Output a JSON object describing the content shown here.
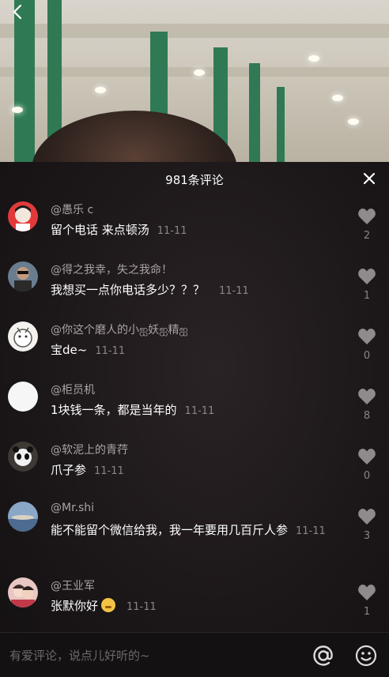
{
  "panel": {
    "title": "981条评论"
  },
  "comments": [
    {
      "user": "@愚乐 c",
      "text": "留个电话 来点顿汤",
      "time": "11-11",
      "likes": "2"
    },
    {
      "user": "@得之我幸，失之我命！",
      "text": "我想买一点你电话多少？？？",
      "time": "11-11",
      "likes": "1"
    },
    {
      "user": "@你这个磨人的小ஐ妖ஐ精ஐ",
      "text": "宝de~",
      "time": "11-11",
      "likes": "0"
    },
    {
      "user": "@柜员机",
      "text": "1块钱一条，都是当年的",
      "time": "11-11",
      "likes": "8"
    },
    {
      "user": "@软泥上的青荇",
      "text": "爪子参",
      "time": "11-11",
      "likes": "0"
    },
    {
      "user": "@Mr.shi",
      "text": "能不能留个微信给我，我一年要用几百斤人参",
      "time": "11-11",
      "likes": "3"
    },
    {
      "user": "@王业军",
      "text": "张默你好",
      "time": "11-11",
      "likes": "1"
    }
  ],
  "input": {
    "placeholder": "有爱评论，说点儿好听的~"
  },
  "icons": {
    "back": "chevron-left-icon",
    "close": "close-icon",
    "like": "heart-icon",
    "at": "at-sign-icon",
    "emoji": "smiley-icon"
  },
  "colors": {
    "panel_bg": "#1c1719",
    "username": "#a9a3a6",
    "text": "#ffffff",
    "muted": "#8a8588",
    "heart": "#8f8a8c"
  }
}
